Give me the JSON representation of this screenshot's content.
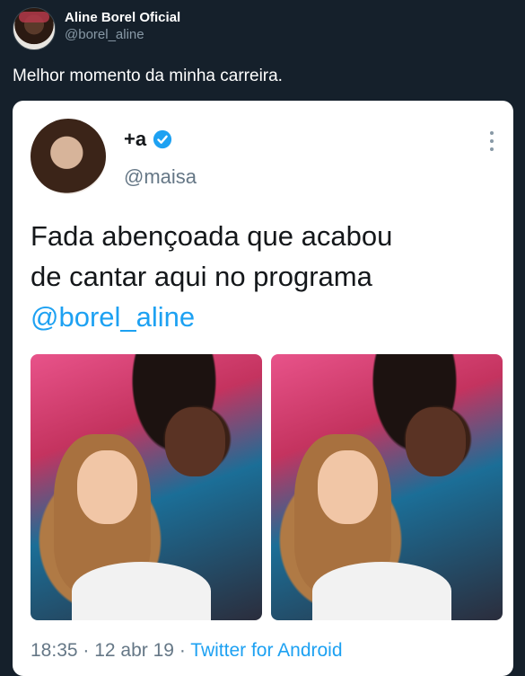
{
  "tweet": {
    "author_name": "Aline Borel Oficial",
    "author_handle": "@borel_aline",
    "text": "Melhor momento da minha carreira."
  },
  "screenshot": {
    "author_name": "+a",
    "author_handle": "@maisa",
    "text_line1": "Fada abençoada que acabou",
    "text_line2": "de cantar aqui no programa",
    "mention": "@borel_aline",
    "time": "18:35",
    "separator1": " · ",
    "date": "12 abr 19",
    "separator2": " · ",
    "source": "Twitter for Android"
  },
  "colors": {
    "background": "#15202b",
    "accent": "#1da1f2",
    "card": "#ffffff"
  },
  "icons": {
    "verified": "verified-badge-icon",
    "more": "more-options-icon"
  }
}
